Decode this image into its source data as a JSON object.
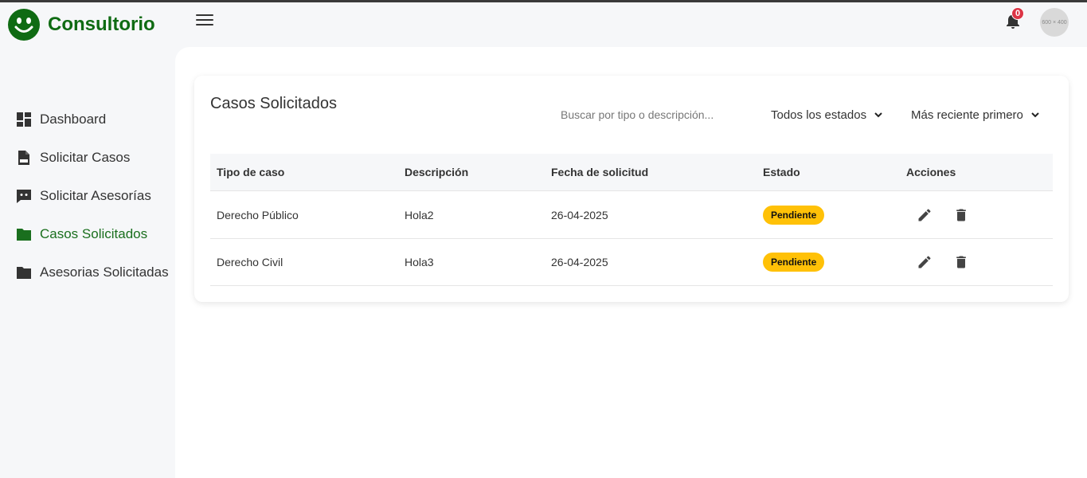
{
  "app": {
    "brand_name": "Consultorio",
    "brand_color": "#0f6b13"
  },
  "header": {
    "notification_count": "0",
    "avatar_text": "600 × 400"
  },
  "sidebar": {
    "items": [
      {
        "label": "Dashboard",
        "icon": "dashboard-icon"
      },
      {
        "label": "Solicitar Casos",
        "icon": "document-icon"
      },
      {
        "label": "Solicitar Asesorías",
        "icon": "chat-icon"
      },
      {
        "label": "Casos Solicitados",
        "icon": "folder-icon",
        "active": true
      },
      {
        "label": "Asesorias Solicitadas",
        "icon": "folder-icon"
      }
    ],
    "active_color": "#1a6f1e"
  },
  "main": {
    "title": "Casos Solicitados",
    "search": {
      "placeholder": "Buscar por tipo o descripción..."
    },
    "status_filter": {
      "selected": "Todos los estados"
    },
    "sort_filter": {
      "selected": "Más reciente primero"
    },
    "table": {
      "headers": [
        "Tipo de caso",
        "Descripción",
        "Fecha de solicitud",
        "Estado",
        "Acciones"
      ],
      "rows": [
        {
          "tipo": "Derecho Público",
          "descripcion": "Hola2",
          "fecha": "26-04-2025",
          "estado": "Pendiente"
        },
        {
          "tipo": "Derecho Civil",
          "descripcion": "Hola3",
          "fecha": "26-04-2025",
          "estado": "Pendiente"
        }
      ]
    },
    "status_color": "#ffc107"
  }
}
